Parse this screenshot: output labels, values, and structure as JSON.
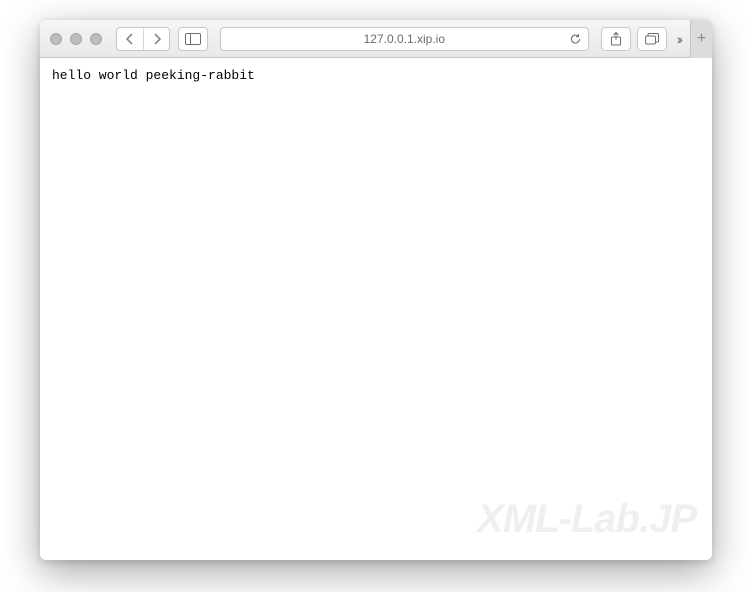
{
  "address": {
    "url": "127.0.0.1.xip.io"
  },
  "page": {
    "body": "hello world peeking-rabbit"
  },
  "watermark": {
    "text": "XML-Lab.JP"
  }
}
